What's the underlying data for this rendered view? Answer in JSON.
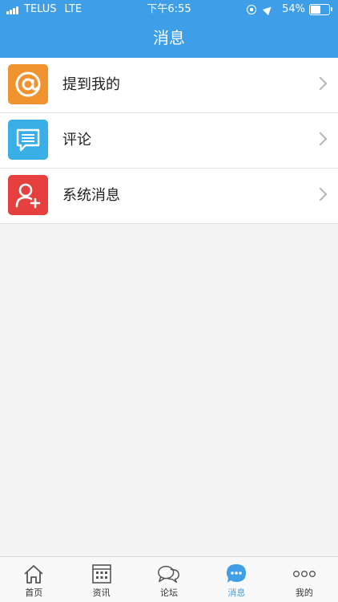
{
  "status_bar": {
    "carrier": "TELUS",
    "network": "LTE",
    "time": "下午6:55",
    "battery_text": "54%",
    "battery_level": 0.54
  },
  "nav": {
    "title": "消息"
  },
  "messages": [
    {
      "label": "提到我的",
      "icon": "at-sign-icon",
      "color": "#f0922e"
    },
    {
      "label": "评论",
      "icon": "comment-icon",
      "color": "#3aaee6"
    },
    {
      "label": "系统消息",
      "icon": "user-add-icon",
      "color": "#e6403e"
    }
  ],
  "tabbar": {
    "active": "消息",
    "tabs": [
      {
        "label": "首页",
        "icon": "home-icon"
      },
      {
        "label": "资讯",
        "icon": "news-grid-icon"
      },
      {
        "label": "论坛",
        "icon": "forum-bubbles-icon"
      },
      {
        "label": "消息",
        "icon": "message-dots-icon"
      },
      {
        "label": "我的",
        "icon": "more-circles-icon"
      }
    ]
  },
  "colors": {
    "primary": "#3f9ee8",
    "background": "#f4f4f4"
  }
}
